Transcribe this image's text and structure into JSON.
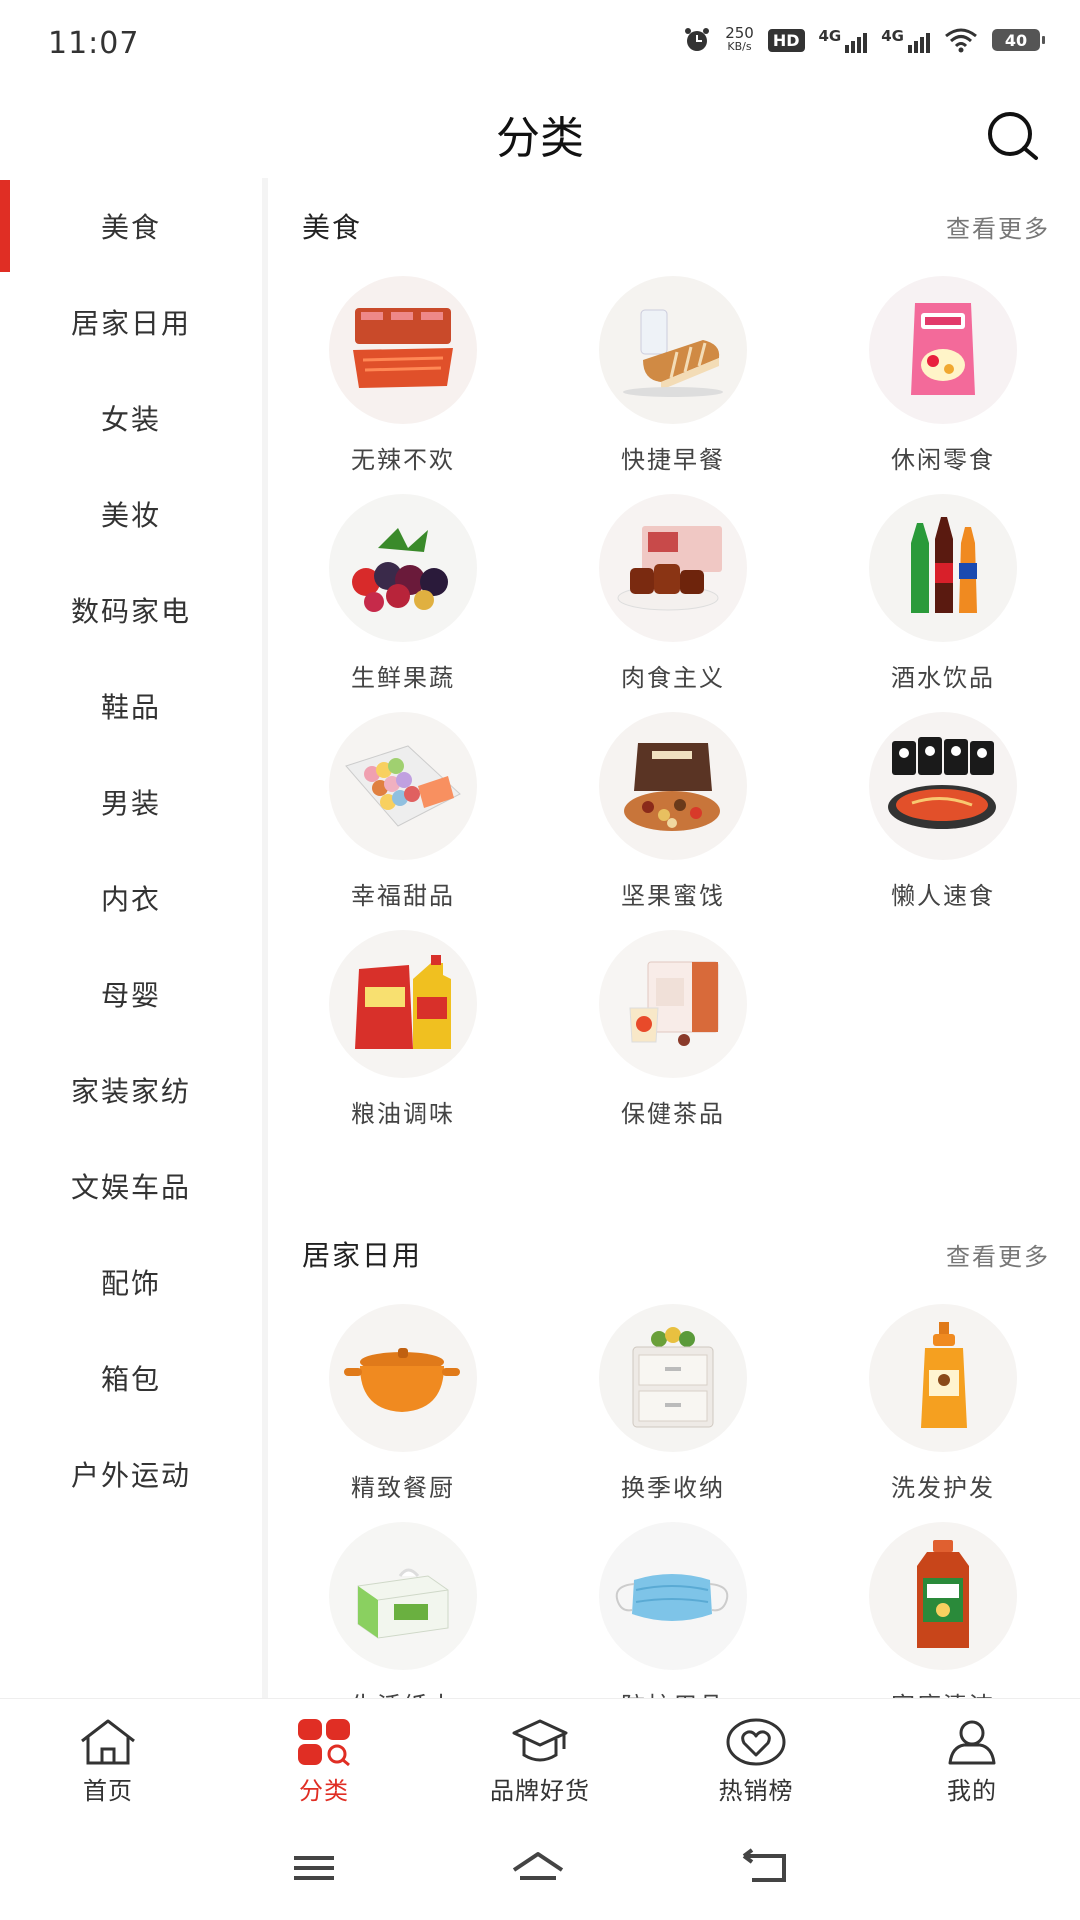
{
  "status": {
    "time": "11:07",
    "net_speed": "250",
    "net_unit": "KB/s",
    "hd": "HD",
    "sim1": "4G",
    "sim2": "4G",
    "battery": "40"
  },
  "header": {
    "title": "分类"
  },
  "sidebar": {
    "items": [
      {
        "label": "美食",
        "active": true
      },
      {
        "label": "居家日用"
      },
      {
        "label": "女装"
      },
      {
        "label": "美妆"
      },
      {
        "label": "数码家电"
      },
      {
        "label": "鞋品"
      },
      {
        "label": "男装"
      },
      {
        "label": "内衣"
      },
      {
        "label": "母婴"
      },
      {
        "label": "家装家纺"
      },
      {
        "label": "文娱车品"
      },
      {
        "label": "配饰"
      },
      {
        "label": "箱包"
      },
      {
        "label": "户外运动"
      }
    ]
  },
  "sections": [
    {
      "title": "美食",
      "more": "查看更多",
      "items": [
        {
          "label": "无辣不欢",
          "icon": "spicy-snack-icon"
        },
        {
          "label": "快捷早餐",
          "icon": "bread-icon"
        },
        {
          "label": "休闲零食",
          "icon": "snack-bag-icon"
        },
        {
          "label": "生鲜果蔬",
          "icon": "berries-icon"
        },
        {
          "label": "肉食主义",
          "icon": "braised-meat-icon"
        },
        {
          "label": "酒水饮品",
          "icon": "drink-bottles-icon"
        },
        {
          "label": "幸福甜品",
          "icon": "macaron-box-icon"
        },
        {
          "label": "坚果蜜饯",
          "icon": "nut-gift-box-icon"
        },
        {
          "label": "懒人速食",
          "icon": "instant-noodle-icon"
        },
        {
          "label": "粮油调味",
          "icon": "rice-oil-icon"
        },
        {
          "label": "保健茶品",
          "icon": "tea-box-icon"
        }
      ]
    },
    {
      "title": "居家日用",
      "more": "查看更多",
      "items": [
        {
          "label": "精致餐厨",
          "icon": "pot-icon"
        },
        {
          "label": "换季收纳",
          "icon": "storage-drawer-icon"
        },
        {
          "label": "洗发护发",
          "icon": "shampoo-bottle-icon"
        },
        {
          "label": "生活纸巾",
          "icon": "tissue-pack-icon"
        },
        {
          "label": "防护用品",
          "icon": "face-mask-icon"
        },
        {
          "label": "家庭清洁",
          "icon": "disinfectant-bottle-icon"
        }
      ]
    }
  ],
  "tabbar": {
    "items": [
      {
        "label": "首页",
        "icon": "home-icon"
      },
      {
        "label": "分类",
        "icon": "category-icon",
        "active": true
      },
      {
        "label": "品牌好货",
        "icon": "graduation-cap-icon"
      },
      {
        "label": "热销榜",
        "icon": "heart-badge-icon"
      },
      {
        "label": "我的",
        "icon": "user-icon"
      }
    ]
  },
  "colors": {
    "accent": "#e02e24",
    "text": "#333333",
    "muted": "#777777"
  }
}
